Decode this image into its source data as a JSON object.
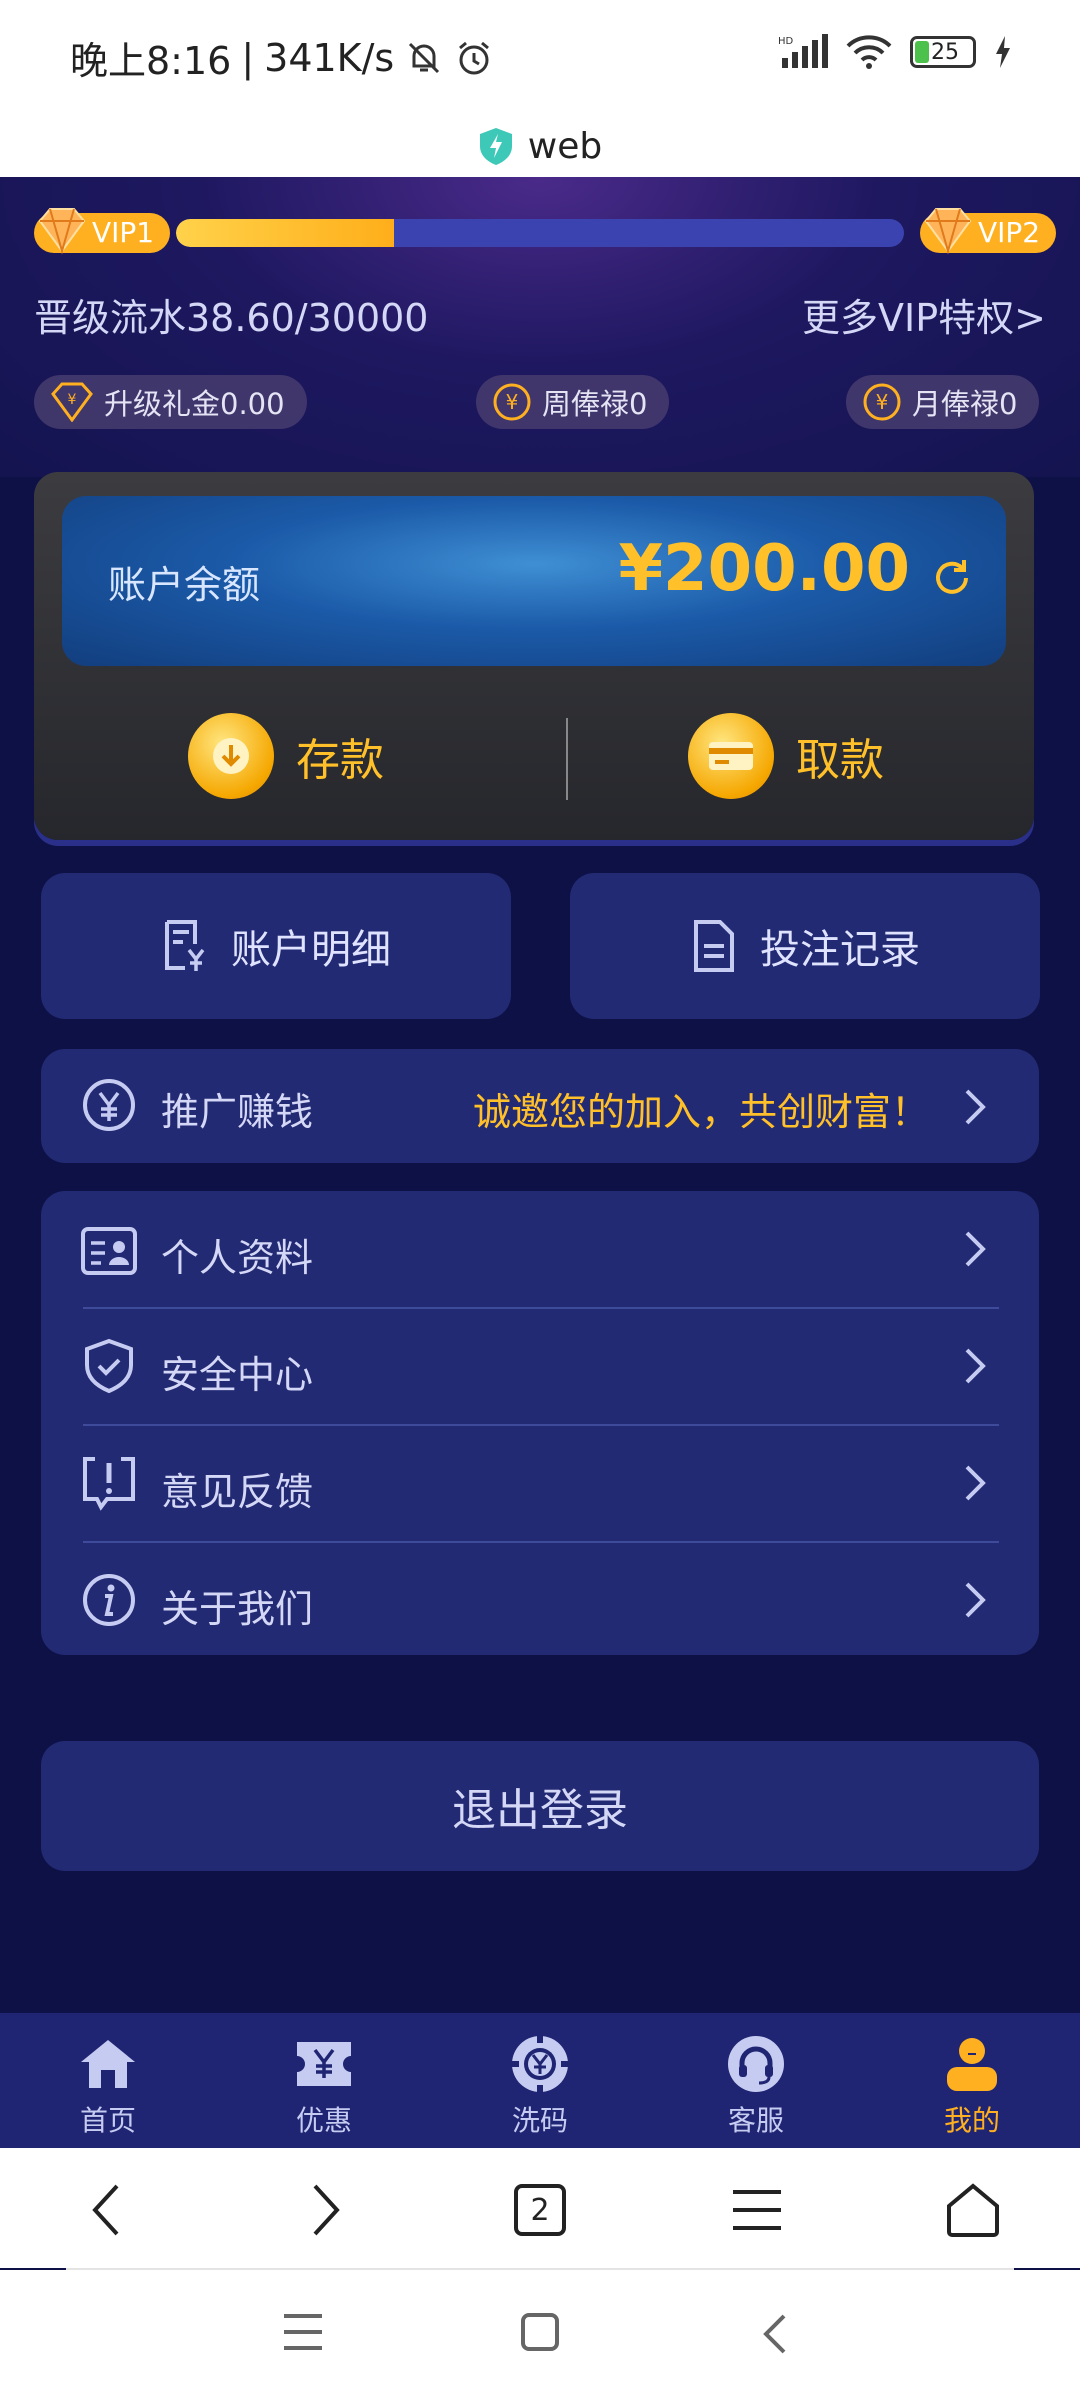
{
  "status_bar": {
    "time": "晚上8:16",
    "speed": "341K/s",
    "battery": "25"
  },
  "browser": {
    "title": "web",
    "tab_count": "2"
  },
  "vip": {
    "current_level": "VIP1",
    "next_level": "VIP2",
    "progress_percent": 30,
    "flow_text": "晋级流水38.60/30000",
    "more_link": "更多VIP特权>",
    "perks": [
      {
        "label": "升级礼金0.00",
        "icon": "diamond-yen-icon"
      },
      {
        "label": "周俸禄0",
        "icon": "yen-coin-icon"
      },
      {
        "label": "月俸禄0",
        "icon": "yen-coin-icon"
      }
    ]
  },
  "balance": {
    "label": "账户余额",
    "amount": "¥200.00",
    "deposit_label": "存款",
    "withdraw_label": "取款"
  },
  "quick": {
    "account_details": "账户明细",
    "bet_records": "投注记录"
  },
  "promo": {
    "title": "推广赚钱",
    "subtitle": "诚邀您的加入，共创财富！"
  },
  "menu": {
    "items": [
      {
        "label": "个人资料",
        "icon": "profile-card-icon"
      },
      {
        "label": "安全中心",
        "icon": "shield-check-icon"
      },
      {
        "label": "意见反馈",
        "icon": "feedback-icon"
      },
      {
        "label": "关于我们",
        "icon": "info-icon"
      }
    ]
  },
  "logout_label": "退出登录",
  "tabs": [
    {
      "label": "首页",
      "icon": "home-icon"
    },
    {
      "label": "优惠",
      "icon": "coupon-icon"
    },
    {
      "label": "洗码",
      "icon": "chip-icon"
    },
    {
      "label": "客服",
      "icon": "headset-icon"
    },
    {
      "label": "我的",
      "icon": "user-icon",
      "active": true
    }
  ],
  "colors": {
    "accent": "#ffb020",
    "background": "#0e1146",
    "card": "#222a73"
  }
}
